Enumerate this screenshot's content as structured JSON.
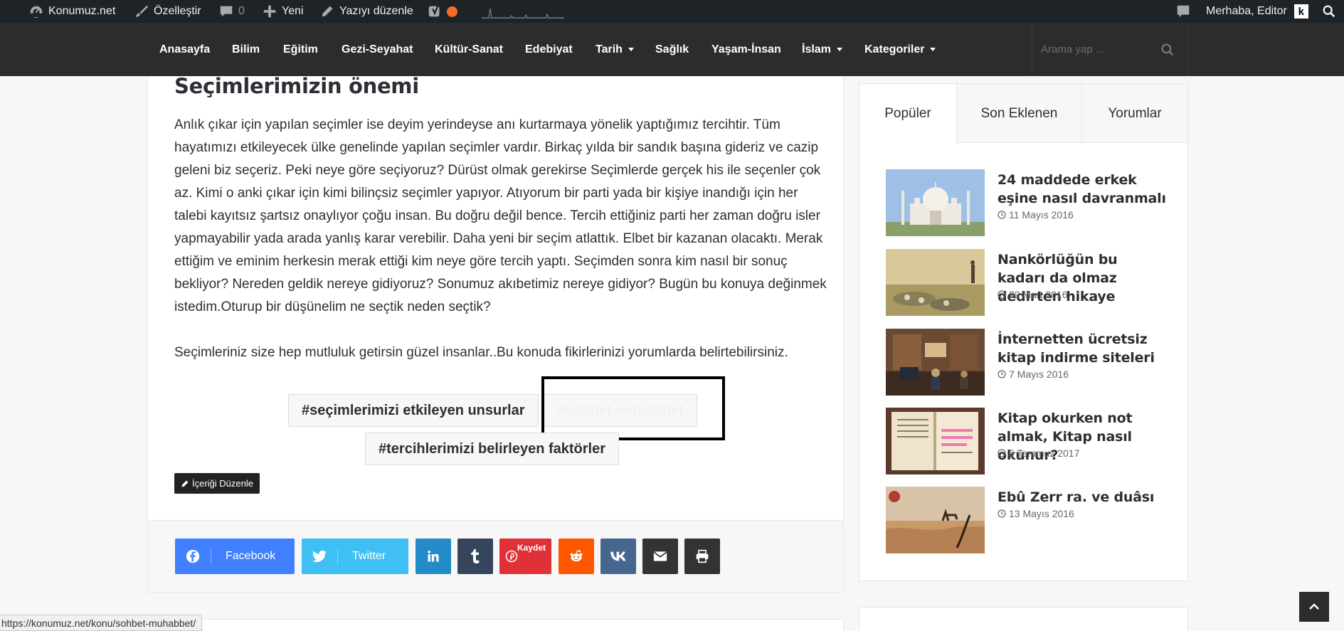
{
  "adminbar": {
    "site": "Konumuz.net",
    "customize": "Özelleştir",
    "comments_count": "0",
    "new": "Yeni",
    "edit_post": "Yazıyı düzenle",
    "greeting": "Merhaba, Editor",
    "avatar_letter": "k"
  },
  "nav": {
    "items": [
      "Anasayfa",
      "Bilim",
      "Eğitim",
      "Gezi-Seyahat",
      "Kültür-Sanat",
      "Edebiyat",
      "Tarih",
      "Sağlık",
      "Yaşam-İnsan",
      "İslam",
      "Kategoriler"
    ],
    "search_placeholder": "Arama yap ..."
  },
  "article": {
    "title": "Seçimlerimizin önemi",
    "paragraph1": "Anlık çıkar için yapılan seçimler ise deyim yerindeyse anı kurtarmaya yönelik yaptığımız tercihtir. Tüm hayatımızı etkileyecek ülke genelinde yapılan seçimler vardır. Birkaç yılda bir sandık başına gideriz ve cazip geleni biz seçeriz. Peki neye göre seçiyoruz? Dürüst olmak gerekirse Seçimlerde gerçek his ile seçenler çok az. Kimi o anki çıkar için kimi bilinçsiz seçimler yapıyor. Atıyorum bir parti yada bir kişiye inandığı için her talebi kayıtsız şartsız onaylıyor çoğu insan. Bu doğru değil bence. Tercih ettiğiniz parti her zaman doğru isler yapmayabilir yada arada yanlış karar verebilir. Daha yeni bir seçim atlattık. Elbet bir kazanan olacaktı. Merak ettiğim ve eminim  herkesin  merak ettiği kim neye göre tercih yaptı. Seçimden sonra kim nasıl bir sonuç bekliyor? Nereden geldik nereye gidiyoruz? Sonumuz akıbetimiz nereye gidiyor? Bugün bu konuya değinmek istedim.Oturup bir düşünelim ne seçtik neden seçtik?",
    "paragraph2": "Seçimleriniz size hep mutluluk getirsin güzel insanlar..Bu konuda fikirlerinizi yorumlarda belirtebilirsiniz.",
    "tags": [
      "#seçimlerimizi etkileyen unsurlar",
      "#sohbet muhabbet",
      "#tercihlerimizi belirleyen faktörler"
    ],
    "edit_button": "İçeriği Düzenle"
  },
  "share": {
    "facebook": "Facebook",
    "twitter": "Twitter",
    "pinterest_save": "Kaydet",
    "colors": {
      "facebook": "#4080ff",
      "twitter": "#40bff5",
      "linkedin": "#238cc8",
      "tumblr": "#35465c",
      "pinterest": "#e13138",
      "reddit": "#ff5700",
      "vk": "#45668e",
      "email": "#333333",
      "print": "#333333"
    }
  },
  "sidebar": {
    "tabs": [
      "Popüler",
      "Son Eklenen",
      "Yorumlar"
    ],
    "posts": [
      {
        "title": "24 maddede erkek eşine nasıl davranmalı",
        "date": "11 Mayıs 2016"
      },
      {
        "title": "Nankörlüğün bu kadarı da olmaz dedirten hikaye",
        "date": "29 Mart 2016"
      },
      {
        "title": "İnternetten ücretsiz kitap indirme siteleri",
        "date": "7 Mayıs 2016"
      },
      {
        "title": "Kitap okurken not almak, Kitap nasıl okunur?",
        "date": "5 Temmuz 2017"
      },
      {
        "title": "Ebû Zerr ra. ve duâsı",
        "date": "13 Mayıs 2016"
      }
    ]
  },
  "statusbar": {
    "url": "https://konumuz.net/konu/sohbet-muhabbet/"
  }
}
